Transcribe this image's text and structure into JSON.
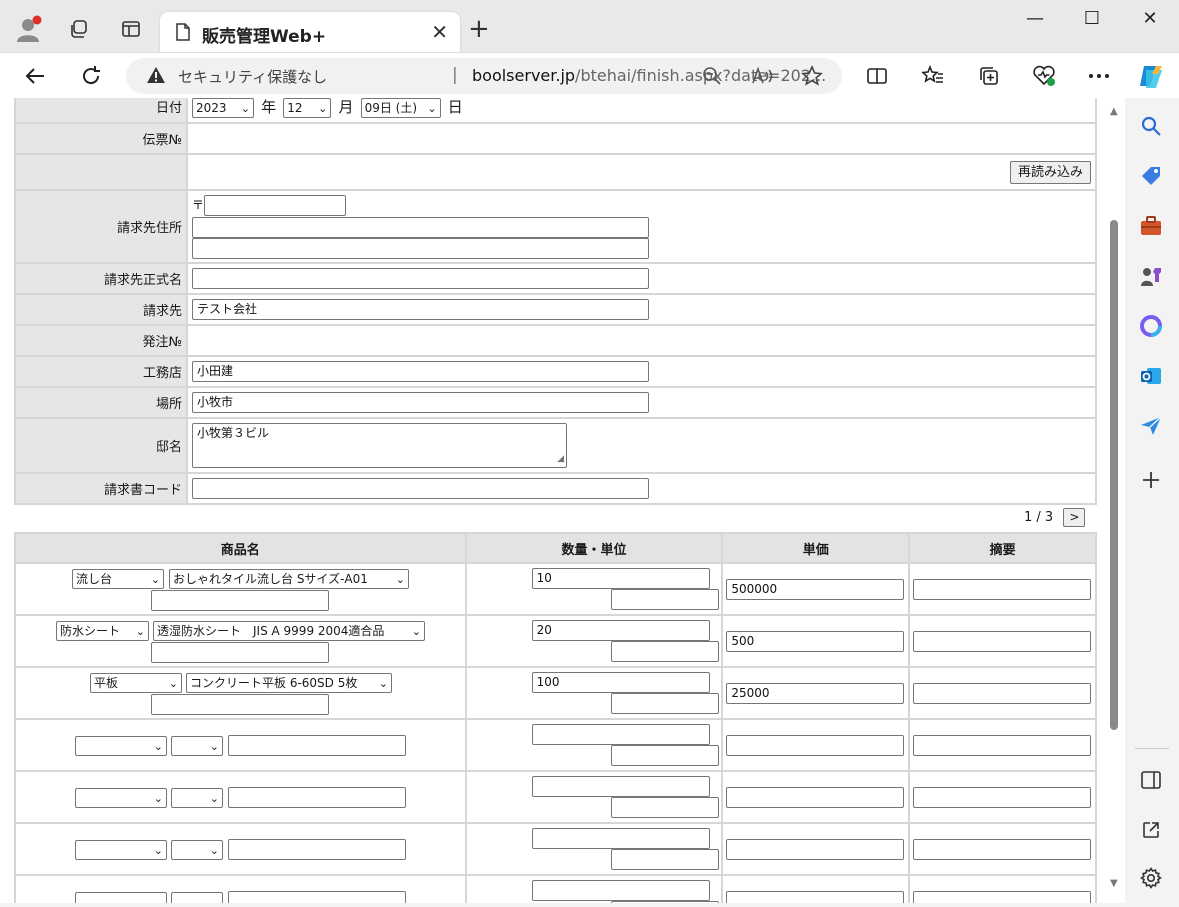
{
  "browser": {
    "tab_title": "販売管理Web+",
    "security_label": "セキュリティ保護なし",
    "url_host": "boolserver.jp",
    "url_path": "/btehai/finish.aspx?date=202..."
  },
  "form": {
    "date_label": "日付",
    "year": "2023",
    "year_unit": "年",
    "month": "12",
    "month_unit": "月",
    "day": "09日 (土)",
    "day_unit": "日",
    "slip_no_label": "伝票№",
    "reload_button": "再読み込み",
    "billing_address_label": "請求先住所",
    "postal_mark": "〒",
    "billing_name_label": "請求先正式名",
    "billing_to_label": "請求先",
    "billing_to_value": "テスト会社",
    "order_no_label": "発注№",
    "contractor_label": "工務店",
    "contractor_value": "小田建",
    "location_label": "場所",
    "location_value": "小牧市",
    "residence_label": "邸名",
    "residence_value": "小牧第３ビル",
    "invoice_code_label": "請求書コード"
  },
  "pager": {
    "text": "1 / 3",
    "next_label": ">"
  },
  "items": {
    "headers": {
      "product": "商品名",
      "quantity": "数量・単位",
      "price": "単価",
      "note": "摘要"
    },
    "rows": [
      {
        "category": "流し台",
        "product": "おしゃれタイル流し台 Sサイズ-A01",
        "qty": "10",
        "price": "500000"
      },
      {
        "category": "防水シート",
        "product": "透湿防水シート　JIS A 9999 2004適合品",
        "qty": "20",
        "price": "500"
      },
      {
        "category": "平板",
        "product": "コンクリート平板 6-60SD 5枚",
        "qty": "100",
        "price": "25000"
      }
    ]
  }
}
